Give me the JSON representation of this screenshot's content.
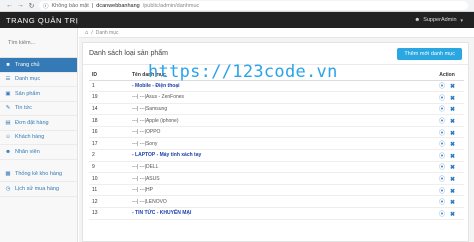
{
  "browser": {
    "security_label": "Không bảo mật",
    "domain": "dcanwebbanhang",
    "path": "/public/admin/danhmuc"
  },
  "topbar": {
    "brand": "TRANG QUẢN TRỊ",
    "user": "SupperAdmin"
  },
  "sidebar": {
    "search_placeholder": "Tìm kiếm...",
    "items": [
      {
        "label": "Trang chủ",
        "icon": "dashboard-icon",
        "active": true
      },
      {
        "label": "Danh mục",
        "icon": "list-icon"
      },
      {
        "label": "Sản phẩm",
        "icon": "product-icon"
      },
      {
        "label": "Tin tức",
        "icon": "news-icon"
      },
      {
        "label": "Đơn đặt hàng",
        "icon": "order-icon"
      },
      {
        "label": "Khách hàng",
        "icon": "customer-icon"
      },
      {
        "label": "Nhân viên",
        "icon": "staff-icon"
      },
      {
        "label": "Thống kê kho hàng",
        "icon": "chart-icon"
      },
      {
        "label": "Lịch sử mua hàng",
        "icon": "history-icon"
      }
    ]
  },
  "breadcrumb": {
    "current": "Danh mục"
  },
  "panel": {
    "title": "Danh sách loại sản phẩm",
    "add_button": "Thêm mới danh mục"
  },
  "table": {
    "columns": [
      "ID",
      "Tên danh mục",
      "Action"
    ],
    "rows": [
      {
        "id": "1",
        "name": "- Mobile - Điện thoại",
        "parent": true
      },
      {
        "id": "19",
        "name": "---| ---|Asus - ZenFones",
        "parent": false
      },
      {
        "id": "14",
        "name": "---| ---|Samsung",
        "parent": false
      },
      {
        "id": "18",
        "name": "---| ---|Apple (iphone)",
        "parent": false
      },
      {
        "id": "16",
        "name": "---| ---|OPPO",
        "parent": false
      },
      {
        "id": "17",
        "name": "---| ---|Sony",
        "parent": false
      },
      {
        "id": "2",
        "name": "- LAPTOP - Máy tính xách tay",
        "parent": true
      },
      {
        "id": "9",
        "name": "---| ---|DELL",
        "parent": false
      },
      {
        "id": "10",
        "name": "---| ---|ASUS",
        "parent": false
      },
      {
        "id": "11",
        "name": "---| ---|HP",
        "parent": false
      },
      {
        "id": "12",
        "name": "---| ---|LENOVO",
        "parent": false
      },
      {
        "id": "13",
        "name": "- TIN TỨC - KHUYẾN MẠI",
        "parent": true
      }
    ]
  },
  "watermark": "https://123code.vn"
}
